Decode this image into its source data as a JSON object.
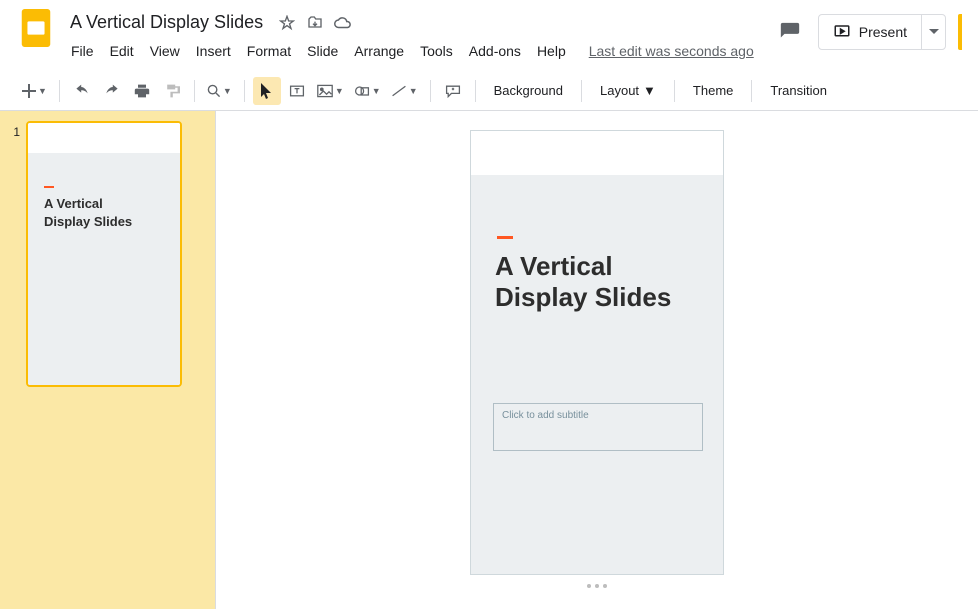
{
  "doc": {
    "title": "A Vertical Display Slides",
    "last_edit": "Last edit was seconds ago"
  },
  "menus": [
    "File",
    "Edit",
    "View",
    "Insert",
    "Format",
    "Slide",
    "Arrange",
    "Tools",
    "Add-ons",
    "Help"
  ],
  "present_label": "Present",
  "toolbar": {
    "background": "Background",
    "layout": "Layout",
    "theme": "Theme",
    "transition": "Transition"
  },
  "filmstrip": {
    "slides": [
      {
        "number": "1",
        "title_line1": "A Vertical",
        "title_line2": "Display Slides"
      }
    ]
  },
  "slide": {
    "title_line1": "A Vertical",
    "title_line2": "Display Slides",
    "subtitle_placeholder": "Click to add subtitle"
  }
}
